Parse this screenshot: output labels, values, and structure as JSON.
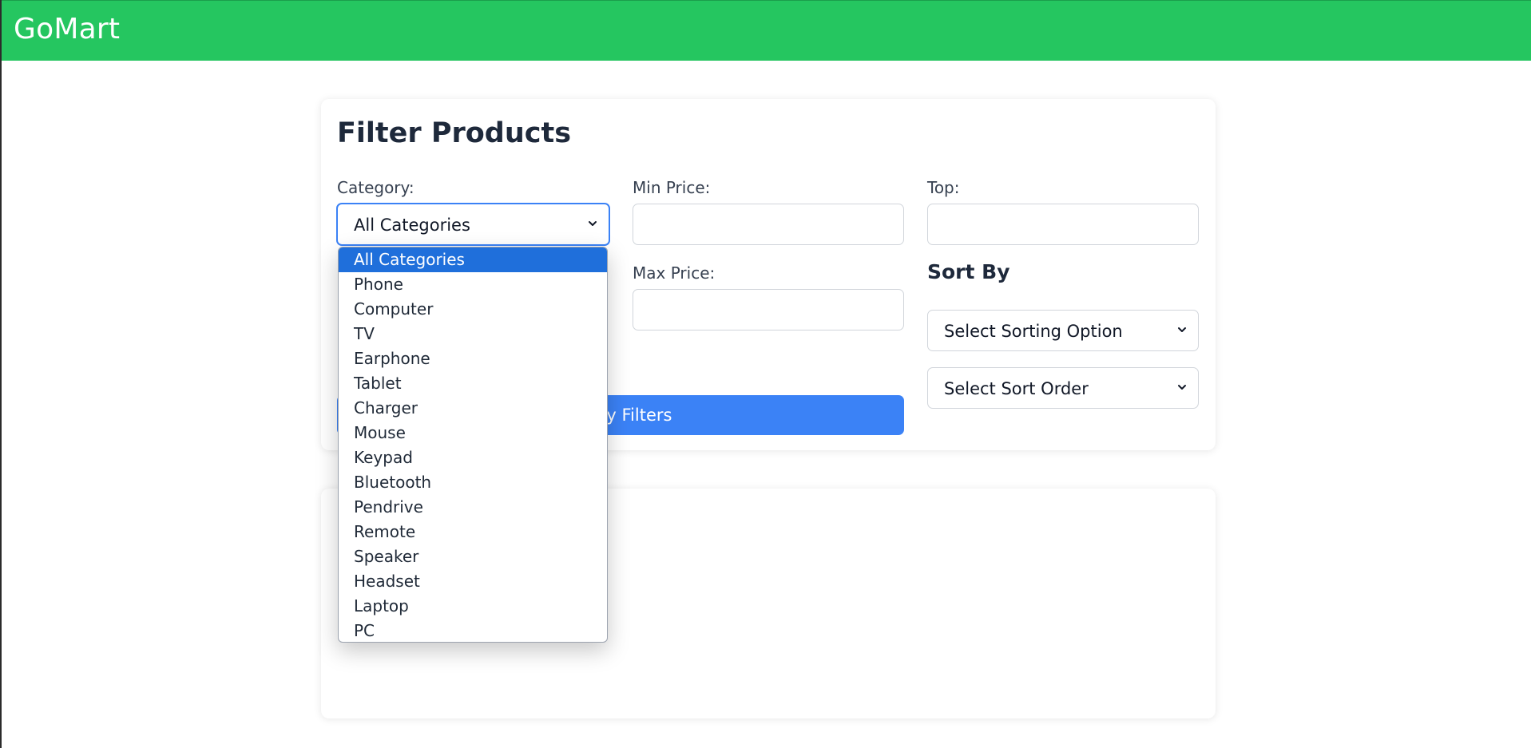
{
  "app": {
    "brand": "GoMart",
    "colors": {
      "navbar": "#25c660",
      "accent": "#3b82f6",
      "selected_option": "#1f6fdb"
    }
  },
  "filter": {
    "title": "Filter Products",
    "category": {
      "label": "Category:",
      "selected": "All Categories",
      "options": [
        "All Categories",
        "Phone",
        "Computer",
        "TV",
        "Earphone",
        "Tablet",
        "Charger",
        "Mouse",
        "Keypad",
        "Bluetooth",
        "Pendrive",
        "Remote",
        "Speaker",
        "Headset",
        "Laptop",
        "PC"
      ]
    },
    "min_price": {
      "label": "Min Price:",
      "value": ""
    },
    "max_price": {
      "label": "Max Price:",
      "value": ""
    },
    "top": {
      "label": "Top:",
      "value": ""
    },
    "sort": {
      "heading": "Sort By",
      "option_select": "Select Sorting Option",
      "order_select": "Select Sort Order"
    },
    "apply_button": "Apply Filters"
  },
  "icons": {
    "select_chevron": "chevron-down-icon"
  }
}
